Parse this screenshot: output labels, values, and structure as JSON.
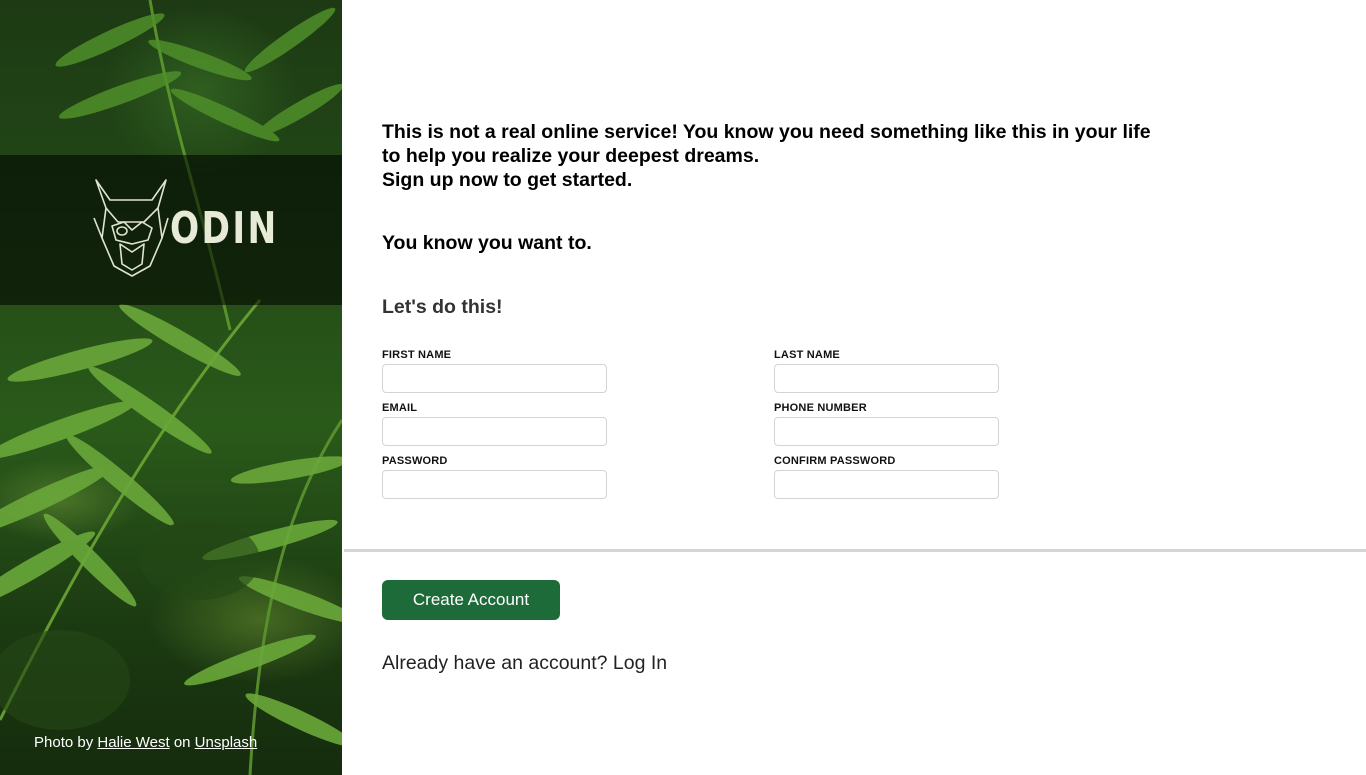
{
  "hero": {
    "logo_icon": "odin-viking-head-icon",
    "brand_name": "ODIN",
    "credit": {
      "prefix": "Photo by",
      "author": "Halie West",
      "middle": "on",
      "source": "Unsplash"
    }
  },
  "intro": {
    "line1": "This is not a real online service! You know you need something like this in your life to help you realize your deepest dreams.",
    "line2": "Sign up now to get started.",
    "tagline": "You know you want to."
  },
  "form": {
    "title": "Let's do this!",
    "fields": {
      "first_name": {
        "label": "FIRST NAME",
        "value": ""
      },
      "last_name": {
        "label": "LAST NAME",
        "value": ""
      },
      "email": {
        "label": "EMAIL",
        "value": ""
      },
      "phone": {
        "label": "PHONE NUMBER",
        "value": ""
      },
      "password": {
        "label": "PASSWORD",
        "value": ""
      },
      "confirm_password": {
        "label": "CONFIRM PASSWORD",
        "value": ""
      }
    }
  },
  "actions": {
    "create_label": "Create Account",
    "login_prompt": "Already have an account?",
    "login_link": "Log In"
  },
  "colors": {
    "button": "#1d6b39",
    "divider": "#d5d5d5"
  }
}
